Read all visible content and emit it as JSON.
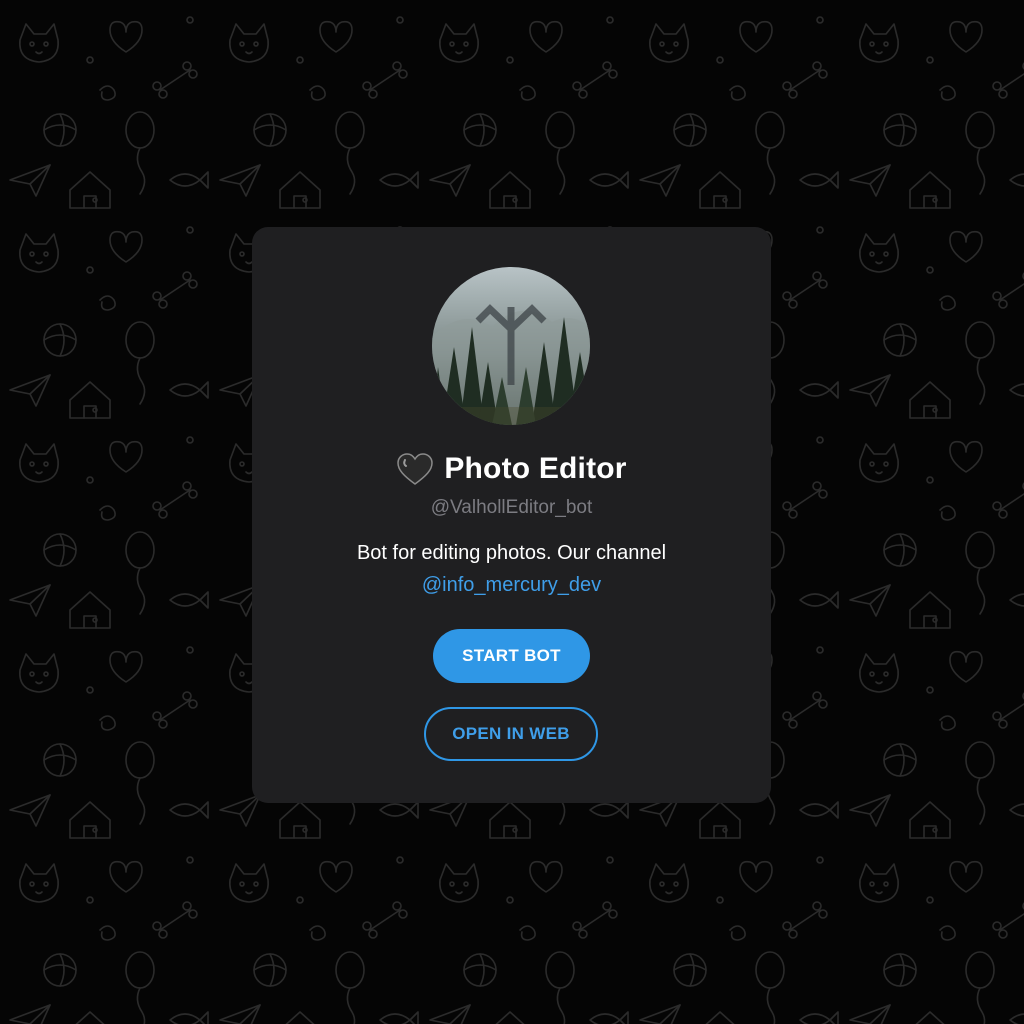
{
  "bot": {
    "name": "Photo Editor",
    "username": "@ValhollEditor_bot",
    "description": "Bot for editing photos. Our channel",
    "channel_link": "@info_mercury_dev",
    "status_emoji": "black-heart-icon"
  },
  "actions": {
    "start_label": "START BOT",
    "open_web_label": "OPEN IN WEB"
  },
  "colors": {
    "background": "#050505",
    "card": "#1f1f21",
    "accent": "#2f97e6",
    "link": "#3f9ee9",
    "muted_text": "#7c7c82",
    "pattern": "#2a2a2a"
  }
}
